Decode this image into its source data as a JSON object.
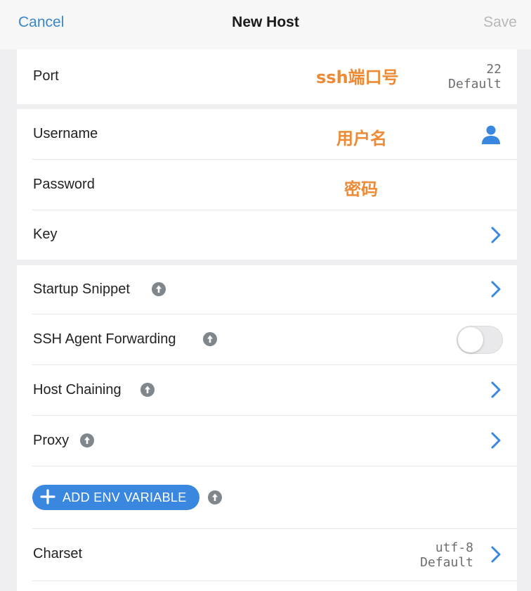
{
  "navbar": {
    "cancel_label": "Cancel",
    "title": "New Host",
    "save_label": "Save"
  },
  "port": {
    "label": "Port",
    "value": "22",
    "value_note": "Default",
    "annotation": "ssh端口号"
  },
  "credentials": {
    "username_label": "Username",
    "username_annotation": "用户名",
    "password_label": "Password",
    "password_annotation": "密码",
    "key_label": "Key"
  },
  "advanced": {
    "startup_snippet_label": "Startup Snippet",
    "agent_forwarding_label": "SSH Agent Forwarding",
    "agent_forwarding_on": false,
    "host_chaining_label": "Host Chaining",
    "proxy_label": "Proxy",
    "add_env_label": "ADD ENV VARIABLE",
    "charset_label": "Charset",
    "charset_value": "utf-8",
    "charset_note": "Default"
  },
  "colors": {
    "accent": "#3a87e0",
    "link": "#3b86c9",
    "annotation": "#ed8a35"
  },
  "icons": [
    "person-icon",
    "chevron-right-icon",
    "info-icon",
    "plus-icon"
  ]
}
